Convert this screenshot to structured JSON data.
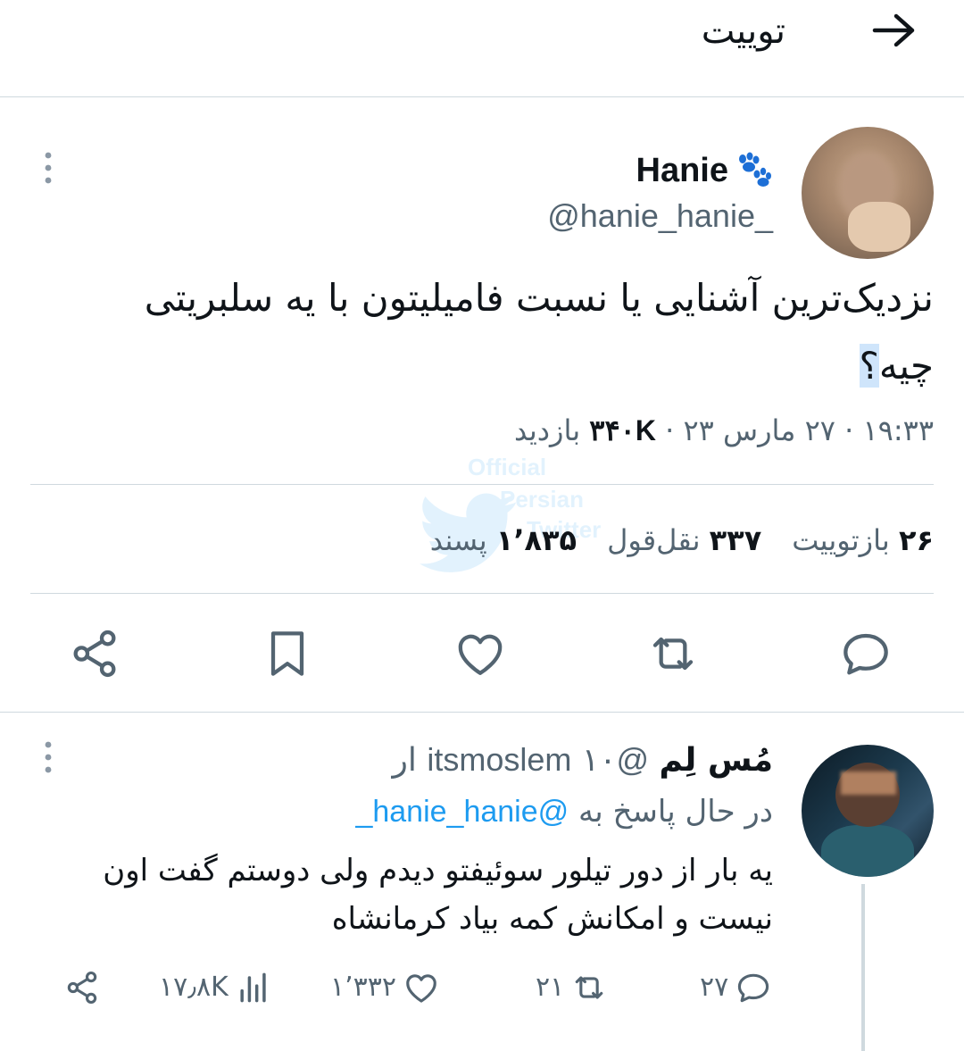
{
  "header": {
    "title": "توییت",
    "back_icon": "arrow-right-icon"
  },
  "main_tweet": {
    "author_name": "Hanie",
    "name_emoji": "paw-prints-icon",
    "handle": "@hanie_hanie_",
    "text_main": "نزدیک‌ترین آشنایی یا نسبت فامیلیتون با یه سلبریتی چیه",
    "text_highlight": "؟",
    "time": "۱۹:۳۳",
    "date": "۲۷ مارس ۲۳",
    "views_count": "۳۴۰K",
    "views_label": "بازدید",
    "separator": "·",
    "stats": {
      "retweets_count": "۲۶",
      "retweets_label": "بازتوییت",
      "quotes_count": "۳۳۷",
      "quotes_label": "نقل‌قول",
      "likes_count": "۱٬۸۳۵",
      "likes_label": "پسند"
    },
    "actions": [
      "reply-icon",
      "retweet-icon",
      "like-icon",
      "bookmark-icon",
      "share-icon"
    ]
  },
  "watermark": {
    "line1": "Official",
    "line2": "Persian",
    "line3": "Twitter"
  },
  "reply": {
    "author_name": "مُس لِم",
    "handle": "@itsmoslem",
    "time": "۱۰ ار",
    "replying_label": "در حال پاسخ به",
    "replying_to": "@hanie_hanie_",
    "text": "یه بار از دور تیلور سوئیفتو دیدم ولی دوستم گفت اون نیست و امکانش کمه بیاد کرمانشاه",
    "counts": {
      "replies": "۲۷",
      "retweets": "۲۱",
      "likes": "۱٬۳۳۲",
      "views": "۱۷٫۸K"
    }
  },
  "colors": {
    "accent": "#1d9bf0",
    "muted": "#536471",
    "text": "#0f1419",
    "border": "#cfd9de"
  }
}
